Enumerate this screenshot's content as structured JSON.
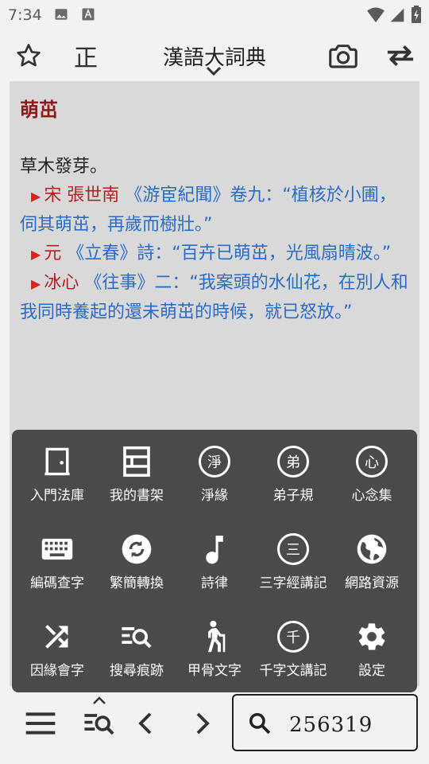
{
  "status_bar": {
    "time": "7:34"
  },
  "app_bar": {
    "title": "漢語大詞典",
    "correct_label": "正"
  },
  "entry": {
    "headword": "萌茁",
    "definition": "草木發芽。",
    "citations": [
      {
        "marker": "▶",
        "source": "宋 張世南",
        "quote": "《游宦紀聞》卷九：“植核於小圃，伺其萌茁，再歲而樹壯。”"
      },
      {
        "marker": "▶",
        "source": "元",
        "quote": "《立春》詩：“百卉已萌茁，光風扇晴波。”"
      },
      {
        "marker": "▶",
        "source": "冰心",
        "quote": "《往事》二：“我案頭的水仙花，在別人和我同時養起的還未萌茁的時候，就已怒放。”"
      }
    ]
  },
  "menu": {
    "items": [
      {
        "label": "入門法庫",
        "icon": "door-icon"
      },
      {
        "label": "我的書架",
        "icon": "bookshelf-icon"
      },
      {
        "label": "淨緣",
        "icon": "jing-circle-icon",
        "glyph": "淨"
      },
      {
        "label": "弟子規",
        "icon": "di-circle-icon",
        "glyph": "弟"
      },
      {
        "label": "心念集",
        "icon": "xin-circle-icon",
        "glyph": "心"
      },
      {
        "label": "編碼查字",
        "icon": "keyboard-icon"
      },
      {
        "label": "繁簡轉換",
        "icon": "sync-icon"
      },
      {
        "label": "詩律",
        "icon": "music-note-icon"
      },
      {
        "label": "三字經講記",
        "icon": "san-circle-icon",
        "glyph": "三"
      },
      {
        "label": "網路資源",
        "icon": "globe-icon"
      },
      {
        "label": "因緣會字",
        "icon": "shuffle-icon"
      },
      {
        "label": "搜尋痕跡",
        "icon": "search-history-icon"
      },
      {
        "label": "甲骨文字",
        "icon": "hiker-icon"
      },
      {
        "label": "千字文講記",
        "icon": "qian-circle-icon",
        "glyph": "千"
      },
      {
        "label": "設定",
        "icon": "gear-icon"
      }
    ]
  },
  "search": {
    "value": "256319"
  }
}
